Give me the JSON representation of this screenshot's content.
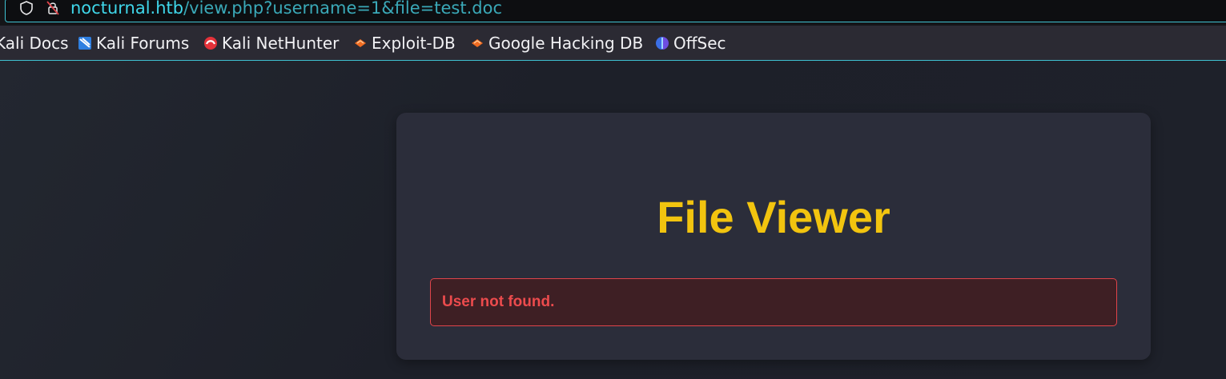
{
  "browser": {
    "url_host": "nocturnal.htb",
    "url_path": "/view.php?username=1&file=test.doc",
    "bookmarks": [
      {
        "label": "Kali Docs",
        "icon": "kali-icon"
      },
      {
        "label": "Kali Forums",
        "icon": "kali-forums-icon"
      },
      {
        "label": "Kali NetHunter",
        "icon": "nethunter-icon"
      },
      {
        "label": "Exploit-DB",
        "icon": "exploit-db-icon"
      },
      {
        "label": "Google Hacking DB",
        "icon": "ghdb-icon"
      },
      {
        "label": "OffSec",
        "icon": "offsec-icon"
      }
    ]
  },
  "page": {
    "title": "File Viewer",
    "error_message": "User not found."
  },
  "colors": {
    "accent_url": "#3fd7ea",
    "title": "#f2c40f",
    "error": "#ec4b4d",
    "card_bg": "#2b2d3a"
  }
}
